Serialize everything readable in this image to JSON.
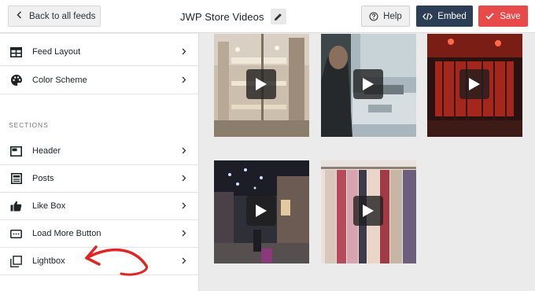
{
  "header": {
    "back_label": "Back to all feeds",
    "title": "JWP Store Videos",
    "help_label": "Help",
    "embed_label": "Embed",
    "save_label": "Save"
  },
  "sidebar": {
    "top_items": [
      {
        "label": "Feed Layout",
        "icon": "feed-layout-icon"
      },
      {
        "label": "Color Scheme",
        "icon": "palette-icon"
      }
    ],
    "sections_heading": "SECTIONS",
    "section_items": [
      {
        "label": "Header",
        "icon": "header-icon"
      },
      {
        "label": "Posts",
        "icon": "posts-icon"
      },
      {
        "label": "Like Box",
        "icon": "thumbs-up-icon"
      },
      {
        "label": "Load More Button",
        "icon": "load-more-icon"
      },
      {
        "label": "Lightbox",
        "icon": "lightbox-icon"
      }
    ]
  },
  "feed": {
    "videos": [
      {
        "scene": "mall atrium",
        "play_icon": "play-icon"
      },
      {
        "scene": "sewing workshop",
        "play_icon": "play-icon"
      },
      {
        "scene": "red-lit store gate",
        "play_icon": "play-icon"
      },
      {
        "scene": "illuminated shopping street",
        "play_icon": "play-icon"
      },
      {
        "scene": "clothing rack",
        "play_icon": "play-icon"
      }
    ]
  },
  "colors": {
    "embed": "#2c3e55",
    "save": "#e84a4a",
    "annotation_arrow": "#e02525",
    "canvas": "#ebebeb"
  }
}
